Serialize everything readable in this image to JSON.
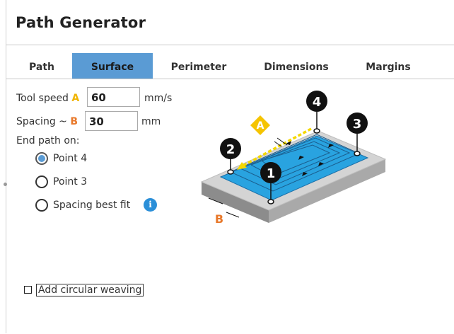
{
  "window": {
    "title": "Path Generator"
  },
  "tabs": [
    {
      "label": "Path",
      "active": false
    },
    {
      "label": "Surface",
      "active": true
    },
    {
      "label": "Perimeter",
      "active": false
    },
    {
      "label": "Dimensions",
      "active": false
    },
    {
      "label": "Margins",
      "active": false
    }
  ],
  "tool_speed": {
    "label": "Tool speed",
    "letter": "A",
    "value": "60",
    "unit": "mm/s"
  },
  "spacing": {
    "label": "Spacing ~",
    "letter": "B",
    "value": "30",
    "unit": "mm"
  },
  "end_path": {
    "label": "End path on:",
    "options": [
      {
        "label": "Point 4",
        "selected": true
      },
      {
        "label": "Point 3",
        "selected": false
      },
      {
        "label": "Spacing best fit",
        "selected": false
      }
    ],
    "info_icon": "i"
  },
  "circular_weaving": {
    "label": "Add circular weaving",
    "checked": false
  },
  "diagram": {
    "point_labels": [
      "1",
      "2",
      "3",
      "4"
    ],
    "letter_a": "A",
    "letter_b": "B"
  },
  "colors": {
    "accent": "#5a9bd4",
    "letter_a": "#f0b400",
    "letter_b": "#e8782a",
    "surface": "#29a3e0"
  }
}
